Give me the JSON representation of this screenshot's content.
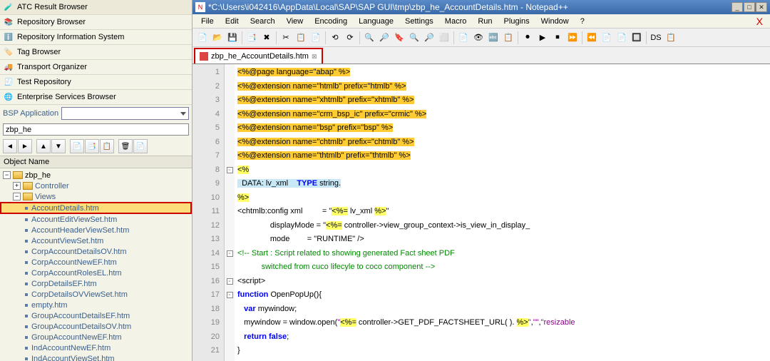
{
  "sap": {
    "toolbars": [
      {
        "icon": "🧪",
        "iconName": "atc-icon",
        "label": "ATC Result Browser"
      },
      {
        "icon": "📚",
        "iconName": "repo-icon",
        "label": "Repository Browser"
      },
      {
        "icon": "ℹ️",
        "iconName": "info-icon",
        "label": "Repository Information System"
      },
      {
        "icon": "🏷️",
        "iconName": "tag-icon",
        "label": "Tag Browser"
      },
      {
        "icon": "🚚",
        "iconName": "transport-icon",
        "label": "Transport Organizer"
      },
      {
        "icon": "🧾",
        "iconName": "test-icon",
        "label": "Test Repository"
      },
      {
        "icon": "🌐",
        "iconName": "ent-icon",
        "label": "Enterprise Services Browser"
      }
    ],
    "filter": {
      "label": "BSP Application",
      "value": "zbp_he"
    },
    "colHeader": "Object Name",
    "tree": {
      "root": "zbp_he",
      "folders": [
        "Controller",
        "Views"
      ],
      "views": [
        "AccountDetails.htm",
        "AccountEditViewSet.htm",
        "AccountHeaderViewSet.htm",
        "AccountViewSet.htm",
        "CorpAccountDetailsOV.htm",
        "CorpAccountNewEF.htm",
        "CorpAccountRolesEL.htm",
        "CorpDetailsEF.htm",
        "CorpDetailsOVViewSet.htm",
        "empty.htm",
        "GroupAccountDetailsEF.htm",
        "GroupAccountDetailsOV.htm",
        "GroupAccountNewEF.htm",
        "IndAccountNewEF.htm",
        "IndAccountViewSet.htm"
      ],
      "selected": "AccountDetails.htm"
    }
  },
  "npp": {
    "title": "*C:\\Users\\i042416\\AppData\\Local\\SAP\\SAP GUI\\tmp\\zbp_he_AccountDetails.htm - Notepad++",
    "menus": [
      "File",
      "Edit",
      "Search",
      "View",
      "Encoding",
      "Language",
      "Settings",
      "Macro",
      "Run",
      "Plugins",
      "Window",
      "?"
    ],
    "tab": "zbp_he_AccountDetails.htm",
    "toolbarIcons": [
      "📄",
      "📂",
      "💾",
      "📑",
      "✖",
      "✂",
      "📋",
      "📄",
      "⟲",
      "⟳",
      "🔍",
      "🔎",
      "🔖",
      "🔍",
      "🔎",
      "⬜",
      "📄",
      "👁",
      "🔤",
      "📋",
      "⏺",
      "▶",
      "⏹",
      "⏩",
      "⏪",
      "📄",
      "📄",
      "🔲",
      "DS",
      "📋"
    ]
  },
  "code": {
    "lines": [
      {
        "n": 1,
        "hl": true,
        "t": "<%@page language=\"abap\" %>"
      },
      {
        "n": 2,
        "hl": true,
        "t": "<%@extension name=\"htmlb\" prefix=\"htmlb\" %>"
      },
      {
        "n": 3,
        "hl": true,
        "t": "<%@extension name=\"xhtmlb\" prefix=\"xhtmlb\" %>"
      },
      {
        "n": 4,
        "hl": true,
        "t": "<%@extension name=\"crm_bsp_ic\" prefix=\"crmic\" %>"
      },
      {
        "n": 5,
        "hl": true,
        "t": "<%@extension name=\"bsp\" prefix=\"bsp\" %>"
      },
      {
        "n": 6,
        "hl": true,
        "t": "<%@extension name=\"chtmlb\" prefix=\"chtmlb\" %>"
      },
      {
        "n": 7,
        "hl": true,
        "t": "<%@extension name=\"thtmlb\" prefix=\"thtmlb\" %>"
      },
      {
        "n": 8,
        "fold": "-",
        "sel": true,
        "kw": "<%"
      },
      {
        "n": 9,
        "sel": true,
        "data": true
      },
      {
        "n": 10,
        "sel": true,
        "kw": "%>"
      },
      {
        "n": 11,
        "cfg": 1
      },
      {
        "n": 12,
        "cfg": 2
      },
      {
        "n": 13,
        "cfg": 3
      },
      {
        "n": 14,
        "fold": "-",
        "com": "<!-- Start : Script related to showing generated Fact sheet PDF"
      },
      {
        "n": 15,
        "com": "           switched from cuco lifecyle to coco component -->"
      },
      {
        "n": 16,
        "fold": "-",
        "script": "<script>"
      },
      {
        "n": 17,
        "fold": "-",
        "func": true
      },
      {
        "n": 18,
        "varline": true
      },
      {
        "n": 19,
        "open": true
      },
      {
        "n": 20,
        "ret": true
      },
      {
        "n": 21,
        "brace": "}"
      }
    ]
  }
}
